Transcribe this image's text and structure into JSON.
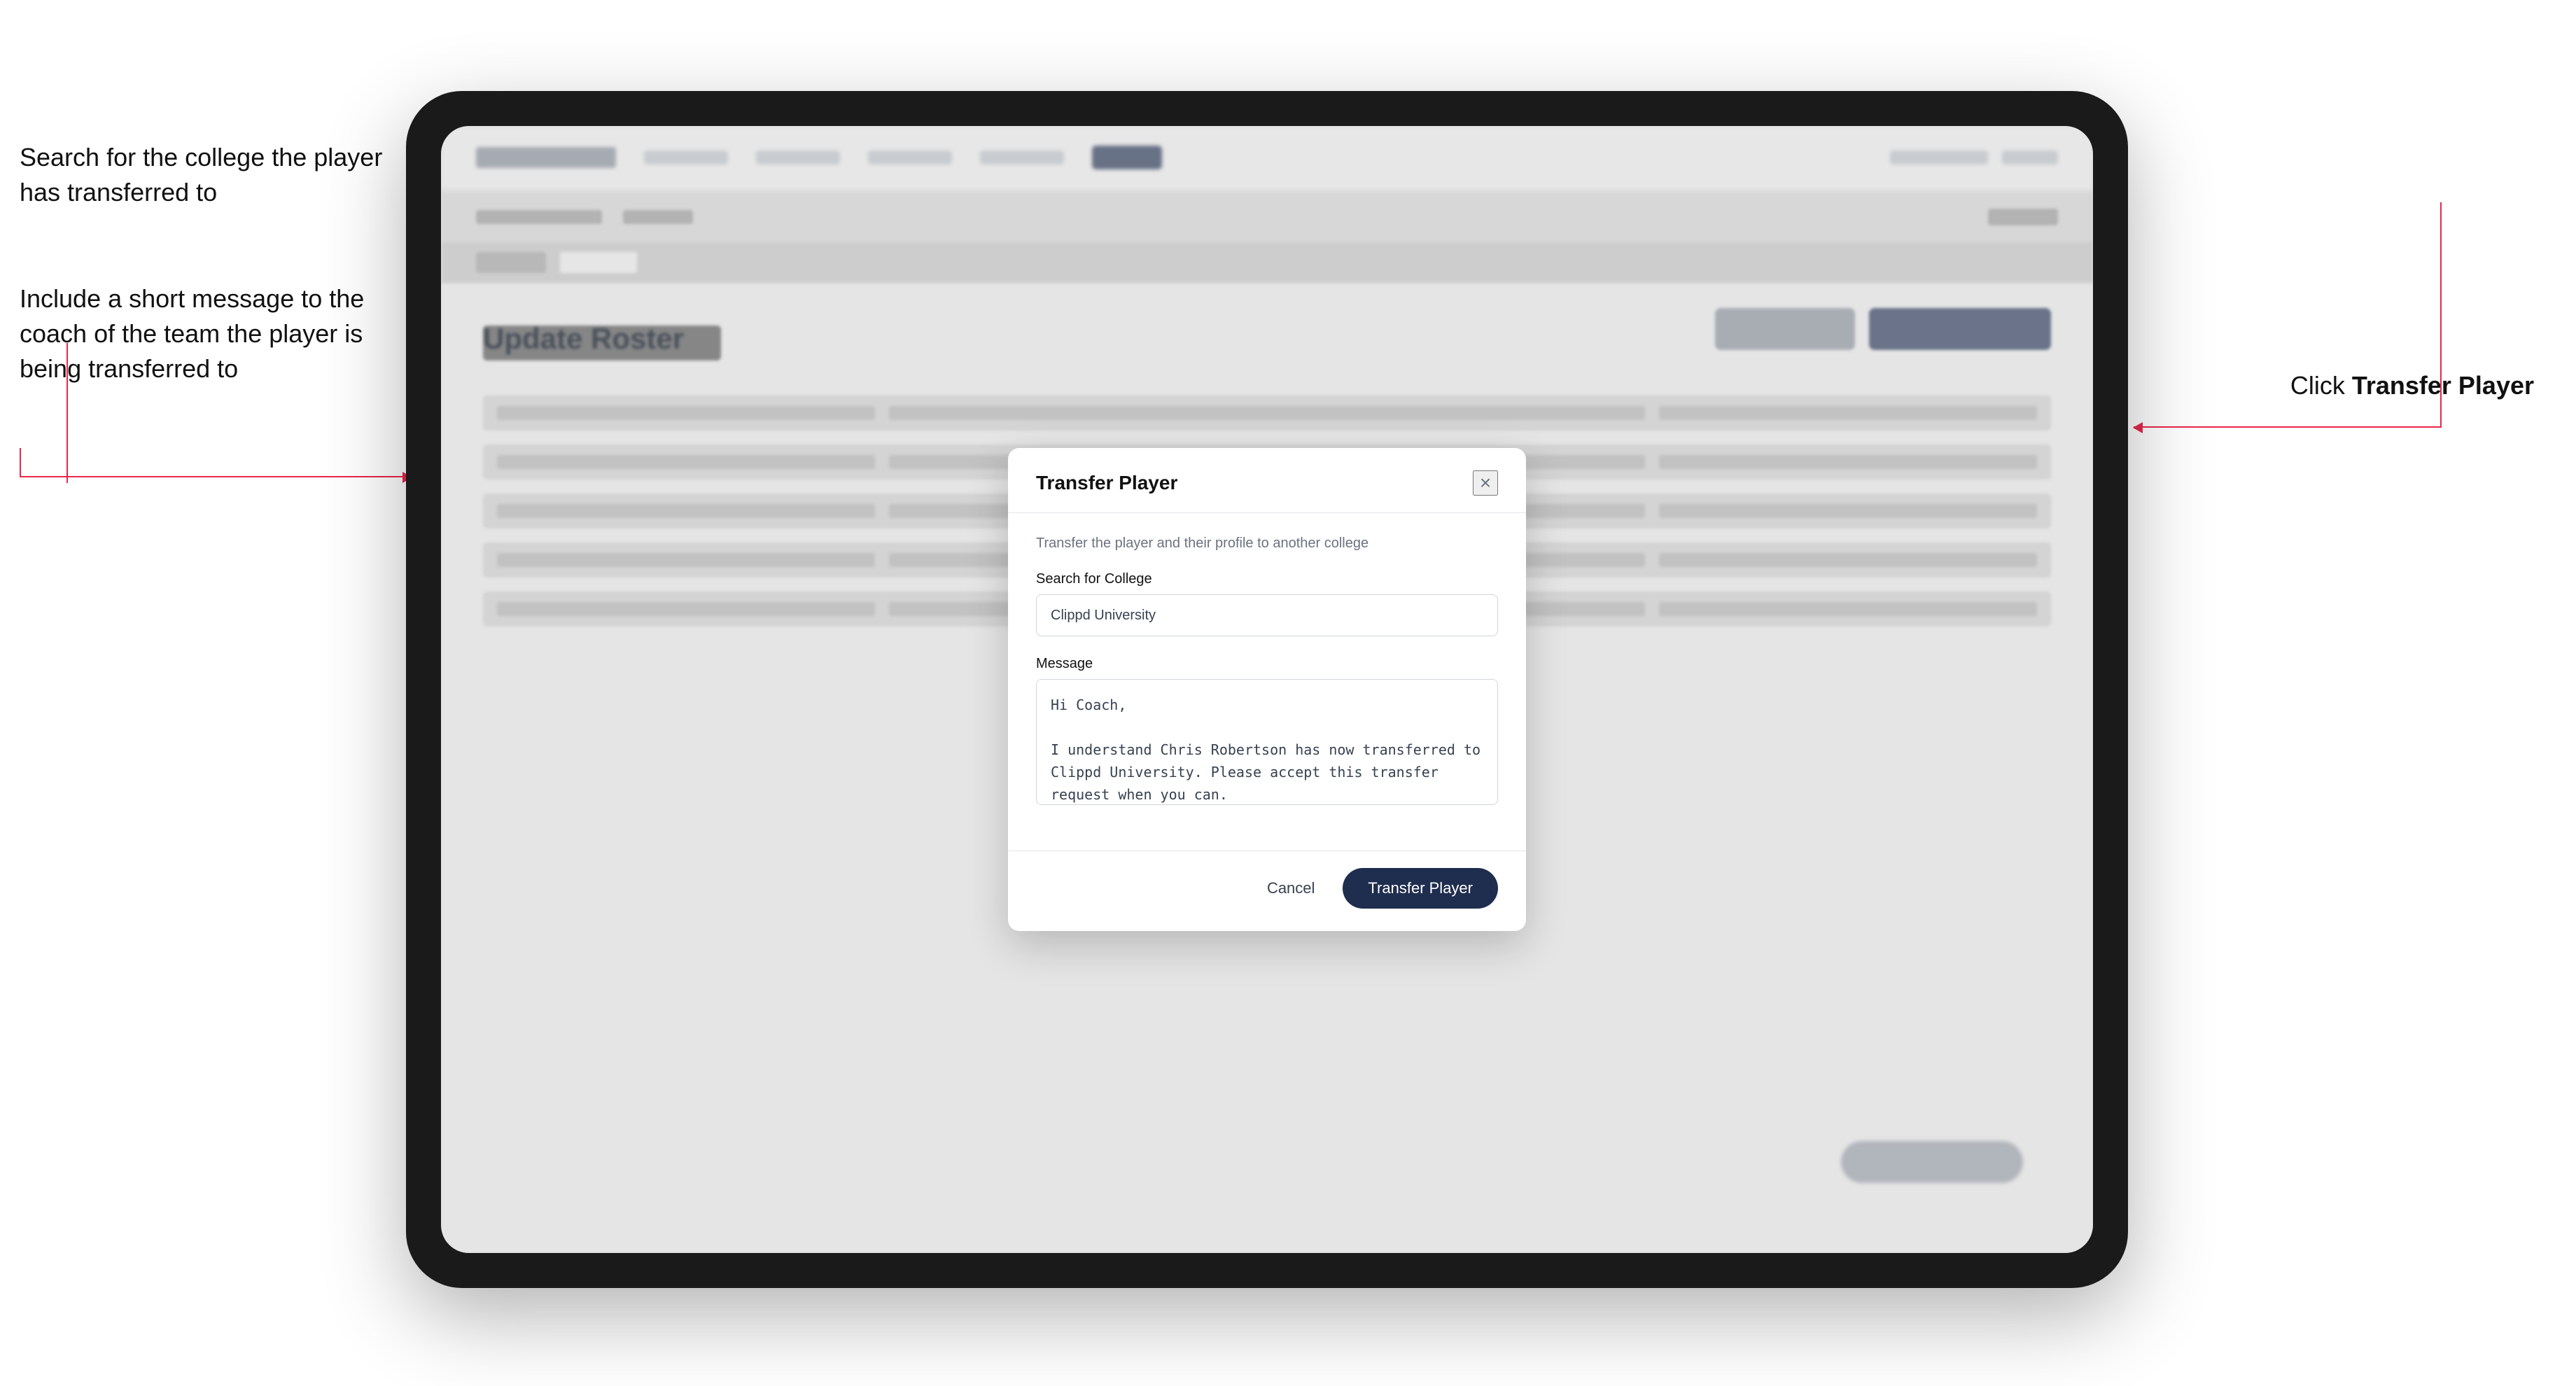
{
  "annotations": {
    "left_top": "Search for the college the player has transferred to",
    "left_bottom": "Include a short message to the coach of the team the player is being transferred to",
    "right": "Click ",
    "right_bold": "Transfer Player"
  },
  "modal": {
    "title": "Transfer Player",
    "subtitle": "Transfer the player and their profile to another college",
    "close_icon": "×",
    "search_label": "Search for College",
    "search_value": "Clippd University",
    "search_placeholder": "Search for College",
    "message_label": "Message",
    "message_value": "Hi Coach,\n\nI understand Chris Robertson has now transferred to Clippd University. Please accept this transfer request when you can.",
    "cancel_label": "Cancel",
    "transfer_label": "Transfer Player"
  },
  "background": {
    "update_roster_title": "Update Roster",
    "nav_items": [
      "Community",
      "Tools",
      "Statistics",
      "More Info",
      "Active"
    ],
    "tab_items": [
      "Roster",
      "Active"
    ]
  }
}
